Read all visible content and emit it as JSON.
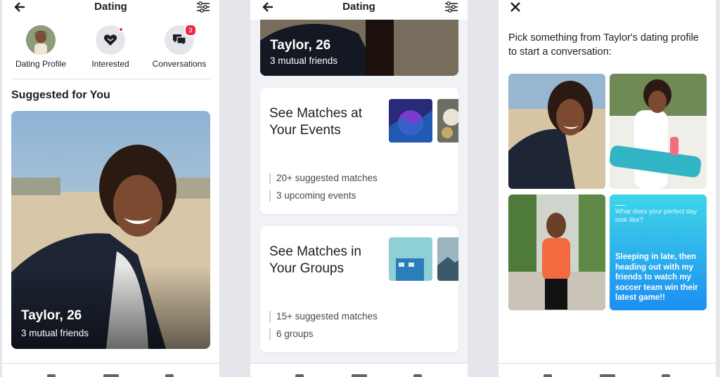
{
  "screen1": {
    "title": "Dating",
    "shortcuts": [
      {
        "label": "Dating Profile"
      },
      {
        "label": "Interested"
      },
      {
        "label": "Conversations",
        "badge": "3"
      }
    ],
    "section_title": "Suggested for You",
    "card": {
      "name": "Taylor, 26",
      "subtitle": "3 mutual friends"
    }
  },
  "screen2": {
    "title": "Dating",
    "top_card": {
      "name": "Taylor, 26",
      "subtitle": "3 mutual friends"
    },
    "cards": [
      {
        "title": "See Matches at Your Events",
        "stats": [
          "20+ suggested matches",
          "3 upcoming events"
        ]
      },
      {
        "title": "See Matches in Your Groups",
        "stats": [
          "15+ suggested matches",
          "6 groups"
        ]
      }
    ]
  },
  "screen3": {
    "prompt": "Pick something from Taylor's dating profile to start a conversation:",
    "question_tile": {
      "question": "What does your perfect day look like?",
      "answer": "Sleeping in late, then heading out with my friends to watch my soccer team win their latest game!!"
    }
  },
  "colors": {
    "badge": "#f02849",
    "question_tile": "#1c8ef2",
    "background": "#e4e6eb"
  }
}
